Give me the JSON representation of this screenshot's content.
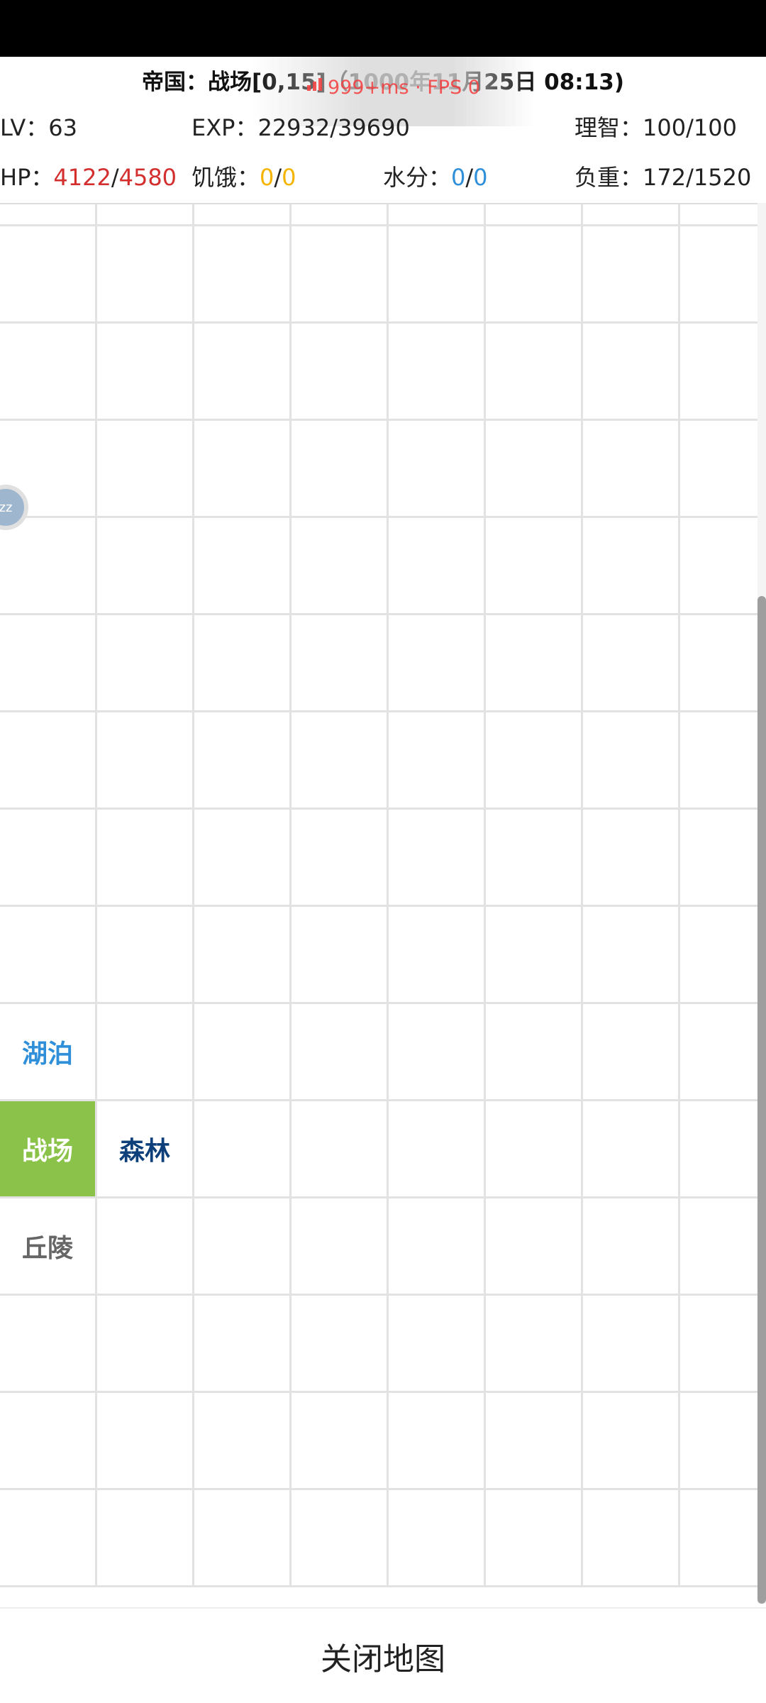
{
  "title": "帝国：战场[0,15]（1000年11月25日 08:13)",
  "overlay": {
    "fps_text": "999+ms · FPS 0"
  },
  "stats": {
    "lv_label": "LV：",
    "lv_value": "63",
    "exp_label": "EXP：",
    "exp_value": "22932/39690",
    "sanity_label": "理智：",
    "sanity_value": "100/100",
    "hp_label": "HP：",
    "hp_current": "4122",
    "hp_max": "4580",
    "hunger_label": "饥饿：",
    "hunger_current": "0",
    "hunger_max": "0",
    "water_label": "水分：",
    "water_current": "0",
    "water_max": "0",
    "weight_label": "负重：",
    "weight_value": "172/1520",
    "sep": "/"
  },
  "player": {
    "marker_text": "zz"
  },
  "map": {
    "columns": 8,
    "rows": 15,
    "labeled_cells": [
      {
        "row": 9,
        "col": 0,
        "label": "湖泊",
        "type": "lake"
      },
      {
        "row": 10,
        "col": 0,
        "label": "战场",
        "type": "battle"
      },
      {
        "row": 10,
        "col": 1,
        "label": "森林",
        "type": "forest"
      },
      {
        "row": 11,
        "col": 0,
        "label": "丘陵",
        "type": "hill"
      }
    ],
    "colors": {
      "battle": "#8bc34a",
      "lake": "#2f8fd8",
      "forest": "#0d3f7a",
      "hill": "#666666"
    }
  },
  "footer": {
    "close_label": "关闭地图"
  }
}
